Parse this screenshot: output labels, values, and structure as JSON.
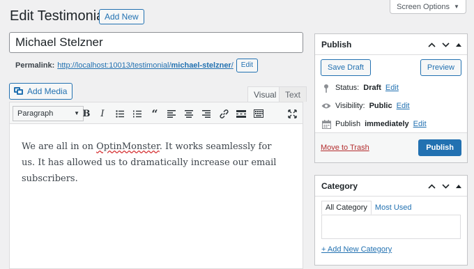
{
  "header": {
    "title": "Edit Testimonial",
    "add_new": "Add New",
    "screen_options": "Screen Options"
  },
  "post": {
    "title": "Michael Stelzner",
    "permalink_label": "Permalink:",
    "permalink_base": "http://localhost:10013/testimonial/",
    "permalink_slug": "michael-stelzner",
    "permalink_trail": "/",
    "permalink_edit": "Edit"
  },
  "editor": {
    "add_media": "Add Media",
    "tab_visual": "Visual",
    "tab_text": "Text",
    "format_select": "Paragraph",
    "toolbar_icons": [
      "bold-icon",
      "italic-icon",
      "bullet-list-icon",
      "numbered-list-icon",
      "blockquote-icon",
      "align-left-icon",
      "align-center-icon",
      "align-right-icon",
      "link-icon",
      "read-more-icon",
      "toolbar-toggle-icon",
      "fullscreen-icon"
    ],
    "content_part1": "We are all in on ",
    "content_misspelled": "OptinMonster",
    "content_part2": ". It works seamlessly for us. It has allowed us to dramatically increase our email subscribers."
  },
  "publish": {
    "title": "Publish",
    "save_draft": "Save Draft",
    "preview": "Preview",
    "status_label": "Status:",
    "status_value": "Draft",
    "visibility_label": "Visibility:",
    "visibility_value": "Public",
    "publish_label": "Publish",
    "publish_when": "immediately",
    "edit": "Edit",
    "move_to_trash": "Move to Trash",
    "publish_button": "Publish"
  },
  "category": {
    "title": "Category",
    "tab_all": "All Category",
    "tab_used": "Most Used",
    "add_new": "+ Add New Category"
  },
  "colors": {
    "accent": "#2271b1",
    "background": "#f0f0f1",
    "trash": "#b32d2e"
  }
}
